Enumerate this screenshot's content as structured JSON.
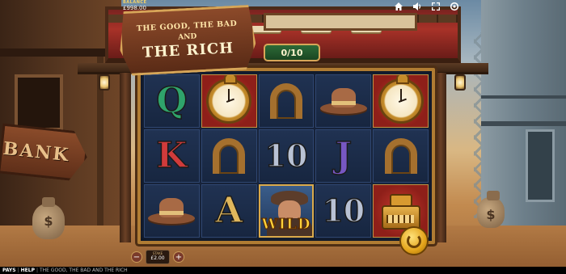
{
  "hud": {
    "balance_label": "BALANCE",
    "balance_value": "£998.00",
    "icons": [
      "home-icon",
      "sound-icon",
      "fullscreen-icon",
      "settings-icon"
    ]
  },
  "logo": {
    "line1": "THE GOOD, THE BAD",
    "line2": "AND",
    "line3": "THE RICH"
  },
  "counter": "0/10",
  "bank_sign": "BANK",
  "reels": [
    [
      {
        "type": "letter",
        "value": "Q",
        "cls": "sym-q"
      },
      {
        "type": "watch"
      },
      {
        "type": "horseshoe"
      },
      {
        "type": "hat"
      },
      {
        "type": "watch"
      }
    ],
    [
      {
        "type": "letter",
        "value": "K",
        "cls": "sym-k"
      },
      {
        "type": "horseshoe"
      },
      {
        "type": "letter",
        "value": "10",
        "cls": "sym-10"
      },
      {
        "type": "letter",
        "value": "J",
        "cls": "sym-j"
      },
      {
        "type": "horseshoe"
      }
    ],
    [
      {
        "type": "hat"
      },
      {
        "type": "letter",
        "value": "A",
        "cls": "sym-a"
      },
      {
        "type": "wild",
        "value": "WILD"
      },
      {
        "type": "letter",
        "value": "10",
        "cls": "sym-10"
      },
      {
        "type": "register"
      }
    ]
  ],
  "stake": {
    "label": "STAKE",
    "value": "£2.00",
    "minus": "−",
    "plus": "+"
  },
  "footer": {
    "paytable": "PAYS",
    "help": "HELP",
    "title": "THE GOOD, THE BAD AND THE RICH"
  },
  "colors": {
    "frame_gold": "#b07c33",
    "reel_bg": "#17233a",
    "wild_yellow": "#ffd23b"
  }
}
